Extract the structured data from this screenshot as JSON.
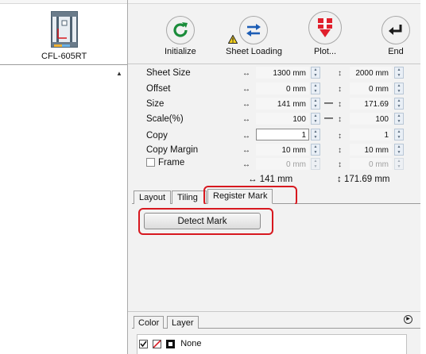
{
  "machine": {
    "label": "CFL-605RT"
  },
  "toolbar": {
    "initialize": "Initialize",
    "sheet_loading": "Sheet Loading",
    "plot": "Plot...",
    "end": "End"
  },
  "params": {
    "sheet_size": {
      "label": "Sheet Size",
      "w": "1300 mm",
      "h": "2000 mm"
    },
    "offset": {
      "label": "Offset",
      "w": "0 mm",
      "h": "0 mm"
    },
    "size": {
      "label": "Size",
      "w": "141 mm",
      "h": "171.69 mm"
    },
    "scale": {
      "label": "Scale(%)",
      "w": "100",
      "h": "100"
    },
    "copy": {
      "label": "Copy",
      "w": "1",
      "h": "1"
    },
    "copy_margin": {
      "label": "Copy Margin",
      "w": "10 mm",
      "h": "10 mm"
    },
    "frame": {
      "label": "Frame",
      "w": "0 mm",
      "h": "0 mm"
    }
  },
  "totals": {
    "w": "141 mm",
    "h": "171.69 mm"
  },
  "tabs": {
    "layout": "Layout",
    "tiling": "Tiling",
    "register_mark": "Register Mark"
  },
  "register_mark": {
    "detect_button": "Detect Mark"
  },
  "lower_tabs": {
    "color": "Color",
    "layer": "Layer"
  },
  "color_list": {
    "item_label": "None"
  },
  "colors": {
    "initialize_green": "#1a8c3a",
    "sheet_blue": "#1c5db5",
    "plot_red": "#e0202c",
    "highlight_red": "#d7181f"
  }
}
